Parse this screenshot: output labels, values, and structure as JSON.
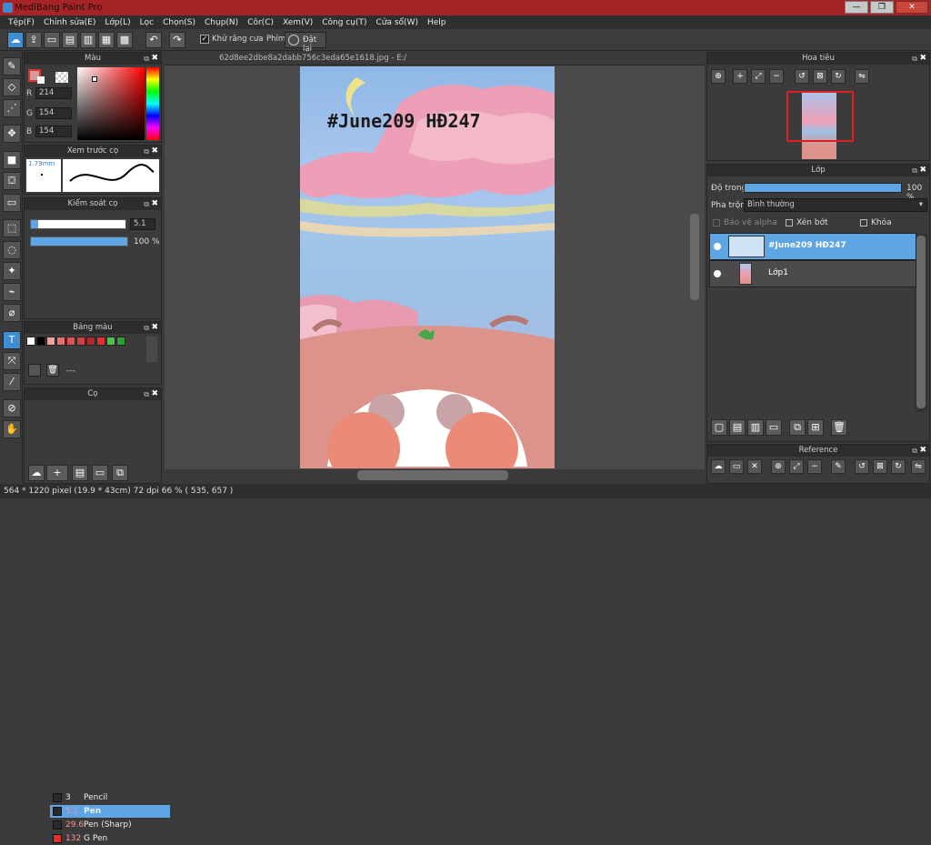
{
  "window": {
    "title": "MediBang Paint Pro",
    "minimize": "—",
    "maximize": "❐",
    "close": "✕"
  },
  "menu": [
    "Tệp(F)",
    "Chỉnh sửa(E)",
    "Lớp(L)",
    "Lọc",
    "Chọn(S)",
    "Chụp(N)",
    "Côr(C)",
    "Xem(V)",
    "Công cụ(T)",
    "Cửa sổ(W)",
    "Help"
  ],
  "toolbar": {
    "antialias_label": "Khử răng cưa",
    "hotkey_label": "Phím",
    "reset_label": "Đặt lại"
  },
  "color_panel": {
    "title": "Màu",
    "r": "214",
    "g": "154",
    "b": "154",
    "r_label": "R",
    "g_label": "G",
    "b_label": "B",
    "current_color": "#d69a9a"
  },
  "brush_preview": {
    "title": "Xem trước cọ",
    "size": "1.79mm"
  },
  "brush_control": {
    "title": "Kiểm soát cọ",
    "size_value": "5.1",
    "opacity_value": "100 %"
  },
  "palette": {
    "title": "Bảng màu",
    "colors": [
      "#ffffff",
      "#000000",
      "#f0a0a0",
      "#e87070",
      "#e05050",
      "#d04040",
      "#b02828",
      "#e03030",
      "#50c050",
      "#30a030"
    ],
    "dash": "---"
  },
  "brush_list": {
    "title": "Cọ",
    "items": [
      {
        "size": "3",
        "name": "Pencil",
        "color": "#2a2a2a"
      },
      {
        "size": "5.1",
        "name": "Pen",
        "color": "#2a2a2a"
      },
      {
        "size": "29.6",
        "name": "Pen (Sharp)",
        "color": "#2a2a2a"
      },
      {
        "size": "132",
        "name": "G Pen",
        "color": "#e03030"
      }
    ]
  },
  "document": {
    "tab": "62d8ee2dbe8a2dabb756c3eda65e1618.jpg - E:/",
    "text_layer": "#June209 HĐ247"
  },
  "navigator": {
    "title": "Hoa tiêu"
  },
  "layer_panel": {
    "title": "Lớp",
    "opacity_label": "Độ trong",
    "opacity_value": "100 %",
    "blend_label": "Pha trộn",
    "blend_value": "Bình thường",
    "protect_alpha": "Bảo vệ alpha",
    "clipping": "Xén bớt",
    "lock": "Khóa",
    "layers": [
      {
        "name": "#June209 HĐ247",
        "selected": true
      },
      {
        "name": "Lớp1",
        "selected": false
      }
    ]
  },
  "reference": {
    "title": "Reference"
  },
  "status": {
    "text": "564 * 1220 pixel  (19.9 * 43cm)  72 dpi  66 %  ( 535, 657 )"
  }
}
